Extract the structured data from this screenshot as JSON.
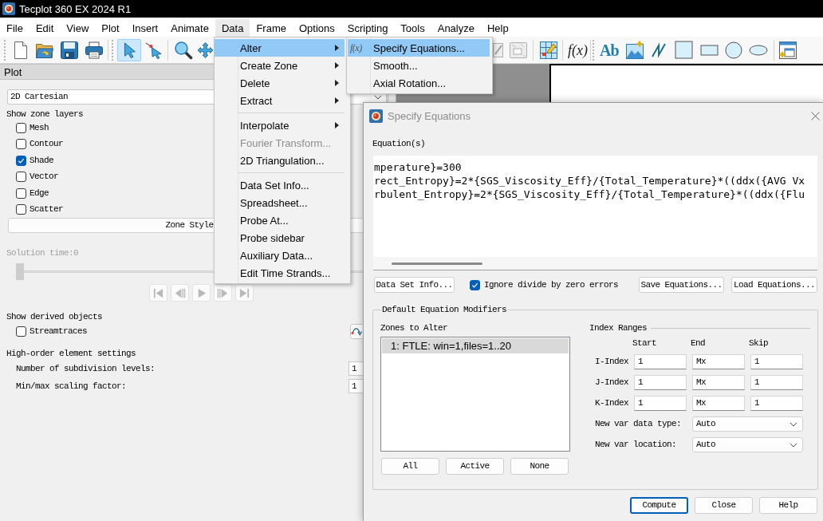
{
  "window": {
    "title": "Tecplot 360 EX 2024 R1"
  },
  "menu_bar": [
    {
      "label": "File",
      "selected": false
    },
    {
      "label": "Edit",
      "selected": false
    },
    {
      "label": "View",
      "selected": false
    },
    {
      "label": "Plot",
      "selected": false
    },
    {
      "label": "Insert",
      "selected": false
    },
    {
      "label": "Animate",
      "selected": false
    },
    {
      "label": "Data",
      "selected": true
    },
    {
      "label": "Frame",
      "selected": false
    },
    {
      "label": "Options",
      "selected": false
    },
    {
      "label": "Scripting",
      "selected": false
    },
    {
      "label": "Tools",
      "selected": false
    },
    {
      "label": "Analyze",
      "selected": false
    },
    {
      "label": "Help",
      "selected": false
    }
  ],
  "toolbar": {
    "pointer_tools": [
      {
        "selected": true
      },
      {
        "selected": false
      }
    ],
    "formula_button": "f(x)",
    "text_button": "Ab"
  },
  "data_menu": {
    "groups": [
      {
        "items": [
          {
            "label": "Alter",
            "submenu": true,
            "selected": true,
            "disabled": false
          },
          {
            "label": "Create Zone",
            "submenu": true,
            "selected": false,
            "disabled": false
          },
          {
            "label": "Delete",
            "submenu": true,
            "selected": false,
            "disabled": false
          },
          {
            "label": "Extract",
            "submenu": true,
            "selected": false,
            "disabled": false
          }
        ]
      },
      {
        "items": [
          {
            "label": "Interpolate",
            "submenu": true,
            "selected": false,
            "disabled": false
          },
          {
            "label": "Fourier Transform...",
            "submenu": false,
            "selected": false,
            "disabled": true
          },
          {
            "label": "2D Triangulation...",
            "submenu": false,
            "selected": false,
            "disabled": false
          }
        ]
      },
      {
        "items": [
          {
            "label": "Data Set Info...",
            "submenu": false,
            "selected": false,
            "disabled": false
          },
          {
            "label": "Spreadsheet...",
            "submenu": false,
            "selected": false,
            "disabled": false
          },
          {
            "label": "Probe At...",
            "submenu": false,
            "selected": false,
            "disabled": false
          },
          {
            "label": "Probe sidebar",
            "submenu": false,
            "selected": false,
            "disabled": false
          },
          {
            "label": "Auxiliary Data...",
            "submenu": false,
            "selected": false,
            "disabled": false
          },
          {
            "label": "Edit Time Strands...",
            "submenu": false,
            "selected": false,
            "disabled": false
          }
        ]
      }
    ]
  },
  "alter_submenu": {
    "items": [
      {
        "label": "Specify Equations...",
        "icon": "f(x)",
        "selected": true
      },
      {
        "label": "Smooth...",
        "selected": false
      },
      {
        "label": "Axial Rotation...",
        "selected": false
      }
    ]
  },
  "plot_panel": {
    "title": "Plot",
    "plot_type": "2D Cartesian",
    "zone_layers_heading": "Show zone layers",
    "zone_layers": [
      {
        "label": "Mesh",
        "checked": false
      },
      {
        "label": "Contour",
        "checked": false
      },
      {
        "label": "Shade",
        "checked": true
      },
      {
        "label": "Vector",
        "checked": false
      },
      {
        "label": "Edge",
        "checked": false
      },
      {
        "label": "Scatter",
        "checked": false
      }
    ],
    "zone_style_button": "Zone Style",
    "solution_time": {
      "label": "Solution time:0",
      "disabled": true,
      "level": 0
    },
    "playback": {
      "disabled": true
    },
    "derived_heading": "Show derived objects",
    "derived_objects": [
      {
        "label": "Streamtraces",
        "checked": false
      }
    ],
    "high_order_heading": "High-order element settings",
    "high_order_fields": [
      {
        "label": "Number of subdivision levels:",
        "value": "1"
      },
      {
        "label": "Min/max scaling factor:",
        "value": "1"
      }
    ]
  },
  "dialog": {
    "title": "Specify Equations",
    "active": false,
    "equations_label": "Equation(s)",
    "equations": [
      "mperature}=300",
      "rect_Entropy}=2*{SGS_Viscosity_Eff}/{Total_Temperature}*((ddx({AVG Vx",
      "rbulent_Entropy}=2*{SGS_Viscosity_Eff}/{Total_Temperature}*((ddx({Flu"
    ],
    "data_set_info_button": "Data Set Info...",
    "ignore_divide_by_zero": {
      "label": "Ignore divide by zero errors",
      "checked": true
    },
    "save_button": "Save Equations...",
    "load_button": "Load Equations...",
    "modifiers": {
      "title": "Default Equation Modifiers",
      "zones_label": "Zones to Alter",
      "zones": [
        {
          "label": "1: FTLE: win=1,files=1..20",
          "selected": true
        }
      ],
      "zone_buttons": [
        "All",
        "Active",
        "None"
      ],
      "index_ranges": {
        "title": "Index Ranges",
        "columns": [
          "Start",
          "End",
          "Skip"
        ],
        "rows": [
          {
            "label": "I-Index",
            "start": "1",
            "end": "Mx",
            "skip": "1"
          },
          {
            "label": "J-Index",
            "start": "1",
            "end": "Mx",
            "skip": "1"
          },
          {
            "label": "K-Index",
            "start": "1",
            "end": "Mx",
            "skip": "1"
          }
        ]
      },
      "data_type": {
        "label": "New var data type:",
        "value": "Auto"
      },
      "location": {
        "label": "New var location:",
        "value": "Auto"
      }
    },
    "buttons": [
      {
        "label": "Compute",
        "default": true
      },
      {
        "label": "Close",
        "default": false
      },
      {
        "label": "Help",
        "default": false
      }
    ]
  }
}
